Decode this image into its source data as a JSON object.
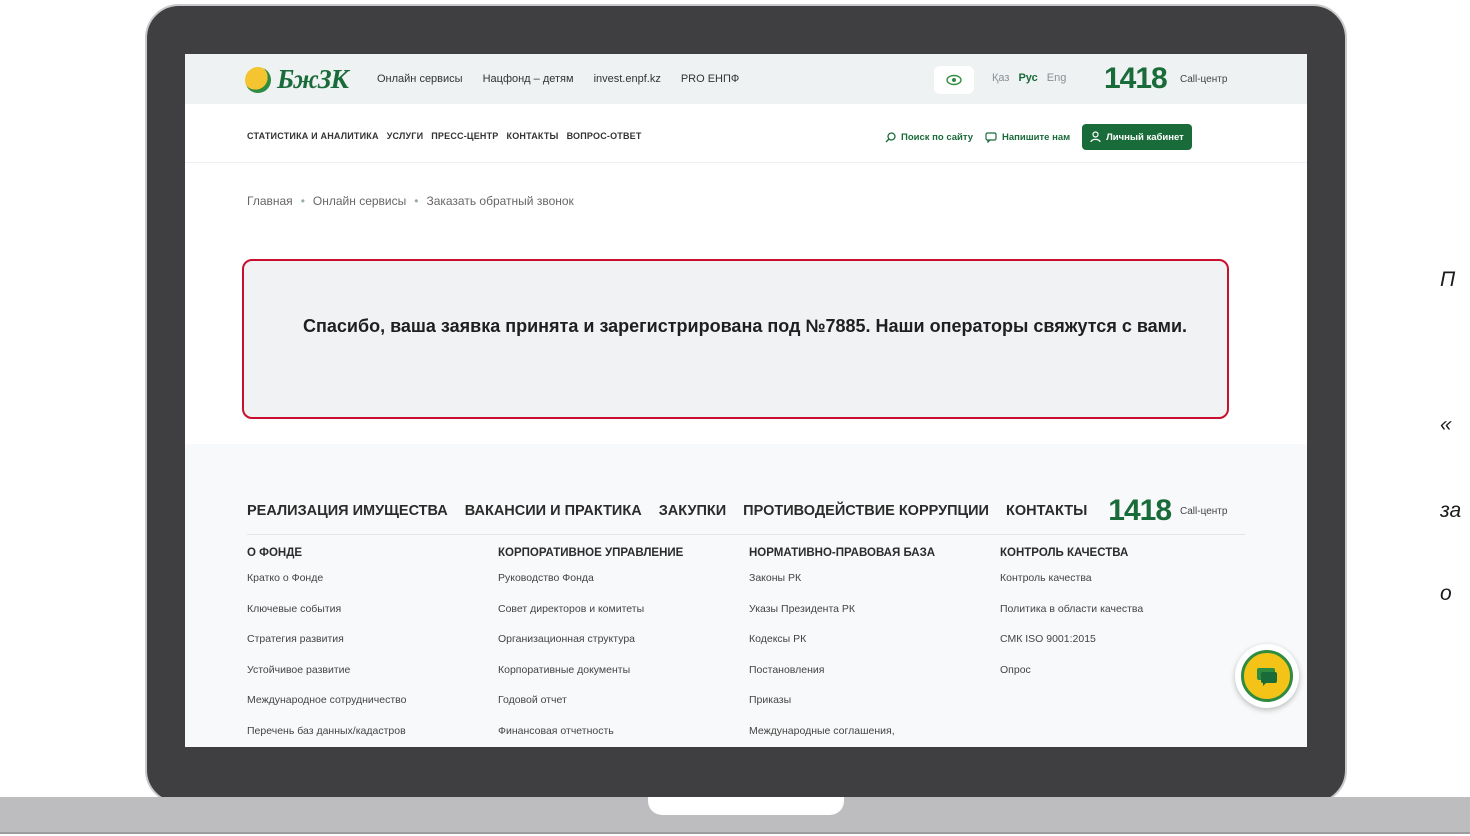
{
  "topbar": {
    "logo_text": "БжЗК",
    "nav": [
      "Онлайн сервисы",
      "Нацфонд – детям",
      "invest.enpf.kz",
      "PRO ЕНПФ"
    ],
    "langs": [
      "Қаз",
      "Рус",
      "Eng"
    ],
    "phone": "1418",
    "phone_label": "Call-центр"
  },
  "subnav": [
    "СТАТИСТИКА И АНАЛИТИКА",
    "УСЛУГИ",
    "ПРЕСС-ЦЕНТР",
    "КОНТАКТЫ",
    "ВОПРОС-ОТВЕТ"
  ],
  "tools": {
    "search": "Поиск по сайту",
    "write": "Напишите нам",
    "cabinet": "Личный кабинет"
  },
  "breadcrumb": [
    "Главная",
    "Онлайн сервисы",
    "Заказать обратный звонок"
  ],
  "notice": "Спасибо, ваша заявка принята и зарегистрирована под №7885. Наши операторы свяжутся с вами.",
  "footer": {
    "nav": [
      "РЕАЛИЗАЦИЯ ИМУЩЕСТВА",
      "ВАКАНСИИ И ПРАКТИКА",
      "ЗАКУПКИ",
      "ПРОТИВОДЕЙСТВИЕ КОРРУПЦИИ",
      "КОНТАКТЫ"
    ],
    "phone": "1418",
    "phone_label": "Call-центр",
    "columns": [
      {
        "title": "О ФОНДЕ",
        "links": [
          "Кратко о Фонде",
          "Ключевые события",
          "Стратегия развития",
          "Устойчивое развитие",
          "Международное сотрудничество",
          "Перечень баз данных/кадастров"
        ]
      },
      {
        "title": "КОРПОРАТИВНОЕ УПРАВЛЕНИЕ",
        "links": [
          "Руководство Фонда",
          "Совет директоров и комитеты",
          "Организационная структура",
          "Корпоративные документы",
          "Годовой отчет",
          "Финансовая отчетность"
        ]
      },
      {
        "title": "НОРМАТИВНО-ПРАВОВАЯ БАЗА",
        "links": [
          "Законы РК",
          "Указы Президента РК",
          "Кодексы РК",
          "Постановления",
          "Приказы",
          "Международные соглашения,"
        ]
      },
      {
        "title": "КОНТРОЛЬ КАЧЕСТВА",
        "links": [
          "Контроль качества",
          "Политика в области качества",
          "СМК ISO 9001:2015",
          "Опрос"
        ]
      }
    ]
  },
  "side_text": [
    "П",
    "«",
    "за",
    "о"
  ],
  "colors": {
    "brand": "#1a6b3a",
    "alert_border": "#c8102e",
    "accent": "#f3c318"
  }
}
